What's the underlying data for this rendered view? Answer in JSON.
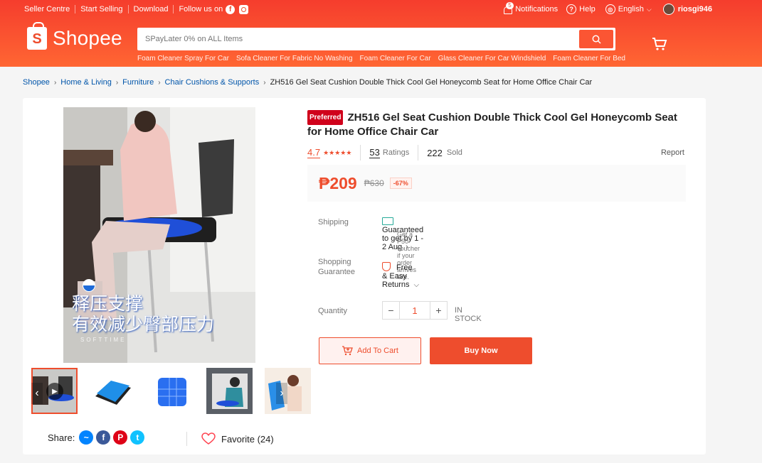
{
  "topbar": {
    "seller_centre": "Seller Centre",
    "start_selling": "Start Selling",
    "download": "Download",
    "follow_us": "Follow us on",
    "notifications": "Notifications",
    "notifications_count": "5",
    "help": "Help",
    "language": "English",
    "username": "riosgi946"
  },
  "logo": {
    "text": "Shopee",
    "glyph": "S"
  },
  "search": {
    "placeholder": "SPayLater 0% on ALL Items",
    "suggestions": [
      "Foam Cleaner Spray For Car",
      "Sofa Cleaner For Fabric No Washing",
      "Foam Cleaner For Car",
      "Glass Cleaner For Car Windshield",
      "Foam Cleaner For Bed"
    ]
  },
  "breadcrumb": [
    "Shopee",
    "Home & Living",
    "Furniture",
    "Chair Cushions & Supports",
    "ZH516 Gel Seat Cushion Double Thick Cool Gel Honeycomb Seat for Home Office Chair Car"
  ],
  "product": {
    "badge": "Preferred",
    "title": "ZH516 Gel Seat Cushion Double Thick Cool Gel Honeycomb Seat for Home Office Chair Car",
    "rating": "4.7",
    "ratings_count": "53",
    "ratings_label": "Ratings",
    "sold_count": "222",
    "sold_label": "Sold",
    "report": "Report",
    "price": "₱209",
    "old_price": "₱630",
    "discount": "-67%",
    "image_caption_line1": "释压支撑",
    "image_caption_line2": "有效减少臀部压力",
    "image_brand": "SOFTTIME"
  },
  "shipping": {
    "label": "Shipping",
    "guarantee": "Guaranteed to get by 1 - 2 Aug",
    "voucher": "Get a ₱50 voucher if your order arrives late."
  },
  "guarantee": {
    "label_line1": "Shopping",
    "label_line2": "Guarantee",
    "value": "Free & Easy Returns"
  },
  "quantity": {
    "label": "Quantity",
    "value": "1",
    "minus": "−",
    "plus": "+",
    "stock": "IN STOCK"
  },
  "actions": {
    "add_to_cart": "Add To Cart",
    "buy_now": "Buy Now"
  },
  "share": {
    "label": "Share:"
  },
  "favorite": {
    "label": "Favorite (24)"
  },
  "colors": {
    "brand": "#ee4d2d",
    "link": "#0055aa"
  }
}
